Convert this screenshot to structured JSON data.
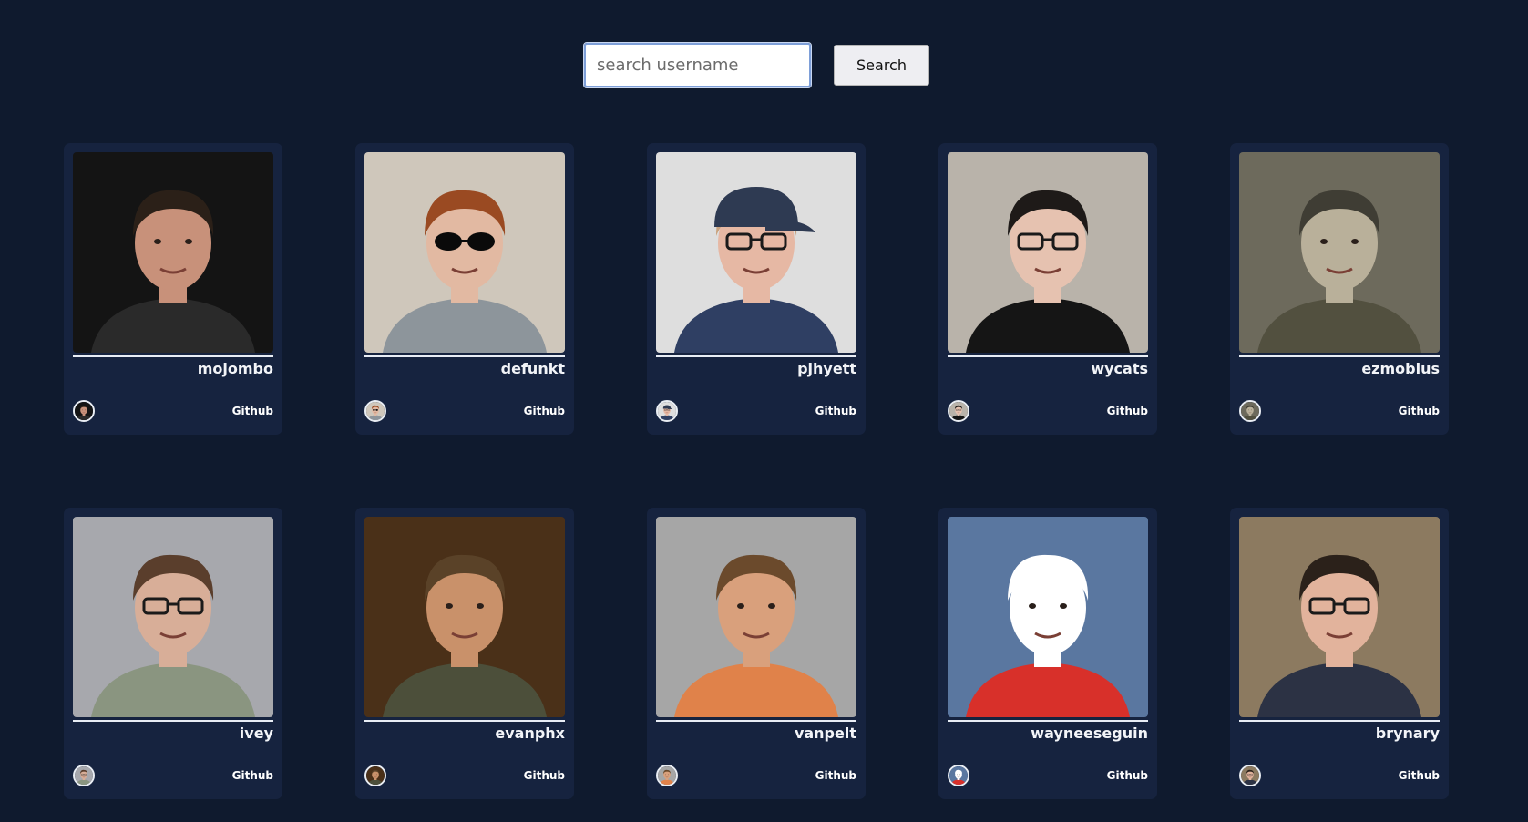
{
  "search": {
    "placeholder": "search username",
    "value": "",
    "button_label": "Search"
  },
  "users": [
    {
      "username": "mojombo",
      "link_label": "Github",
      "bg": "#141414",
      "skin": "#c8917a",
      "hair": "#2b2018",
      "shirt": "#2a2a2a",
      "glasses": false,
      "sunglasses": false,
      "cap": false
    },
    {
      "username": "defunkt",
      "link_label": "Github",
      "bg": "#cfc7bb",
      "skin": "#e2b9a2",
      "hair": "#9a4a22",
      "shirt": "#8d959b",
      "glasses": false,
      "sunglasses": true,
      "cap": false
    },
    {
      "username": "pjhyett",
      "link_label": "Github",
      "bg": "#dedede",
      "skin": "#e6b8a4",
      "hair": "#c9a27d",
      "shirt": "#2f3f63",
      "glasses": true,
      "sunglasses": false,
      "cap": true
    },
    {
      "username": "wycats",
      "link_label": "Github",
      "bg": "#b9b3aa",
      "skin": "#e6c2b0",
      "hair": "#1e1a18",
      "shirt": "#151515",
      "glasses": true,
      "sunglasses": false,
      "cap": false
    },
    {
      "username": "ezmobius",
      "link_label": "Github",
      "bg": "#6d6a5c",
      "skin": "#b9b09a",
      "hair": "#3f3d34",
      "shirt": "#52503f",
      "glasses": false,
      "sunglasses": false,
      "cap": false
    },
    {
      "username": "ivey",
      "link_label": "Github",
      "bg": "#a7a8ad",
      "skin": "#d8ae98",
      "hair": "#5a3e2c",
      "shirt": "#8a9580",
      "glasses": true,
      "sunglasses": false,
      "cap": false
    },
    {
      "username": "evanphx",
      "link_label": "Github",
      "bg": "#4a3018",
      "skin": "#c9916a",
      "hair": "#5a4228",
      "shirt": "#4c4f3a",
      "glasses": false,
      "sunglasses": false,
      "cap": false
    },
    {
      "username": "vanpelt",
      "link_label": "Github",
      "bg": "#a6a6a6",
      "skin": "#d9a07c",
      "hair": "#6b4a2c",
      "shirt": "#e0824a",
      "glasses": false,
      "sunglasses": false,
      "cap": false
    },
    {
      "username": "wayneeseguin",
      "link_label": "Github",
      "bg": "#5a77a0",
      "skin": "#ffffff",
      "hair": "#ffffff",
      "shirt": "#d8302a",
      "glasses": false,
      "sunglasses": false,
      "cap": false
    },
    {
      "username": "brynary",
      "link_label": "Github",
      "bg": "#8c7a60",
      "skin": "#e2b39c",
      "hair": "#2b211a",
      "shirt": "#2c3244",
      "glasses": true,
      "sunglasses": false,
      "cap": false
    }
  ]
}
